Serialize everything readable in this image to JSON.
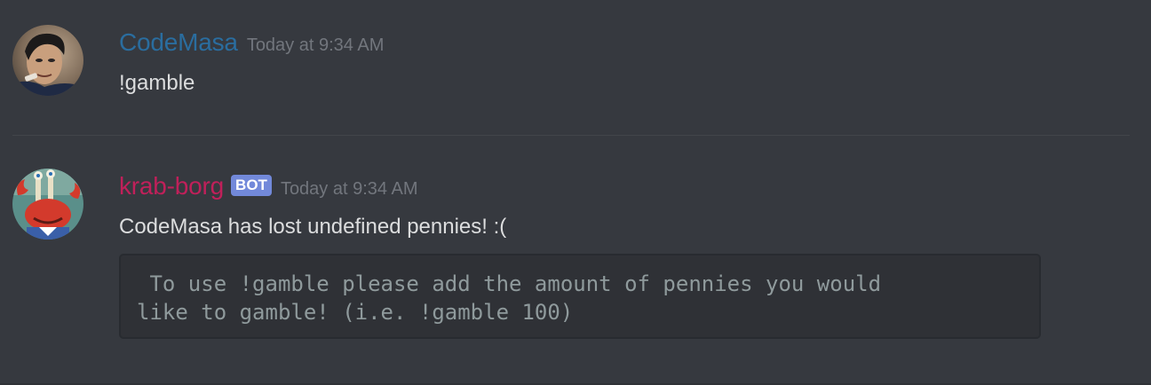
{
  "messages": [
    {
      "author": "CodeMasa",
      "author_color": "#2a6d9f",
      "timestamp": "Today at 9:34 AM",
      "text": "!gamble",
      "avatar": "user-photo-avatar"
    },
    {
      "author": "krab-borg",
      "author_color": "#c0205a",
      "badge": "BOT",
      "timestamp": "Today at 9:34 AM",
      "text": "CodeMasa has lost undefined pennies! :(",
      "code_block": " To use !gamble please add the amount of pennies you would\nlike to gamble! (i.e. !gamble 100)",
      "avatar": "mr-krabs-avatar"
    }
  ],
  "colors": {
    "background": "#36393f",
    "codeblock_bg": "#2f3136",
    "timestamp": "#72767d",
    "text": "#dcddde",
    "bot_tag": "#7289da"
  }
}
